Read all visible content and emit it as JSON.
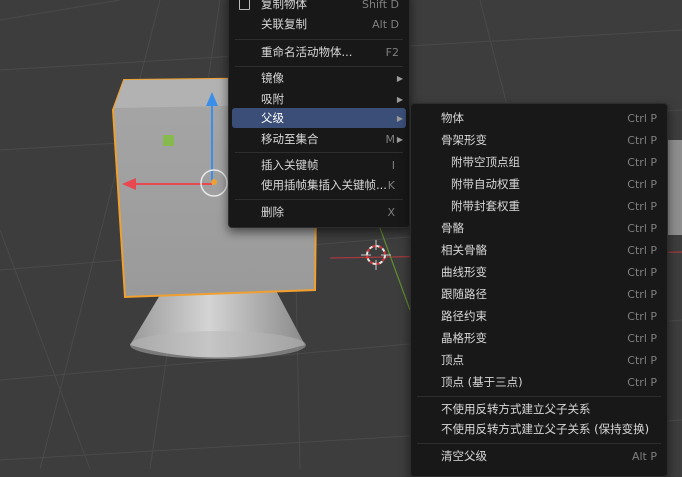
{
  "context_menu": {
    "items": [
      {
        "label": "复制物体",
        "shortcut": "Shift D"
      },
      {
        "label": "关联复制",
        "shortcut": "Alt D"
      },
      {
        "label": "重命名活动物体...",
        "shortcut": "F2"
      },
      {
        "label": "镜像"
      },
      {
        "label": "吸附"
      },
      {
        "label": "父级"
      },
      {
        "label": "移动至集合",
        "shortcut": "M"
      },
      {
        "label": "插入关键帧",
        "shortcut": "I"
      },
      {
        "label": "使用插帧集插入关键帧...",
        "shortcut": "K"
      },
      {
        "label": "删除",
        "shortcut": "X"
      }
    ]
  },
  "parent_submenu": {
    "items": [
      {
        "label": "物体",
        "shortcut": "Ctrl P"
      },
      {
        "label": "骨架形变",
        "shortcut": "Ctrl P"
      },
      {
        "label": "附带空顶点组",
        "shortcut": "Ctrl P"
      },
      {
        "label": "附带自动权重",
        "shortcut": "Ctrl P"
      },
      {
        "label": "附带封套权重",
        "shortcut": "Ctrl P"
      },
      {
        "label": "骨骼",
        "shortcut": "Ctrl P"
      },
      {
        "label": "相关骨骼",
        "shortcut": "Ctrl P"
      },
      {
        "label": "曲线形变",
        "shortcut": "Ctrl P"
      },
      {
        "label": "跟随路径",
        "shortcut": "Ctrl P"
      },
      {
        "label": "路径约束",
        "shortcut": "Ctrl P"
      },
      {
        "label": "晶格形变",
        "shortcut": "Ctrl P"
      },
      {
        "label": "顶点",
        "shortcut": "Ctrl P"
      },
      {
        "label": "顶点 (基于三点)",
        "shortcut": "Ctrl P"
      },
      {
        "label": "不使用反转方式建立父子关系"
      },
      {
        "label": "不使用反转方式建立父子关系 (保持变换)"
      },
      {
        "label": "清空父级",
        "shortcut": "Alt P"
      }
    ]
  },
  "colors": {
    "active_highlight": "#3a4e78",
    "selection_outline": "#f0a030",
    "x_axis": "#e8484f",
    "z_axis": "#3b8fe8",
    "y_axis": "#7fc13a"
  }
}
